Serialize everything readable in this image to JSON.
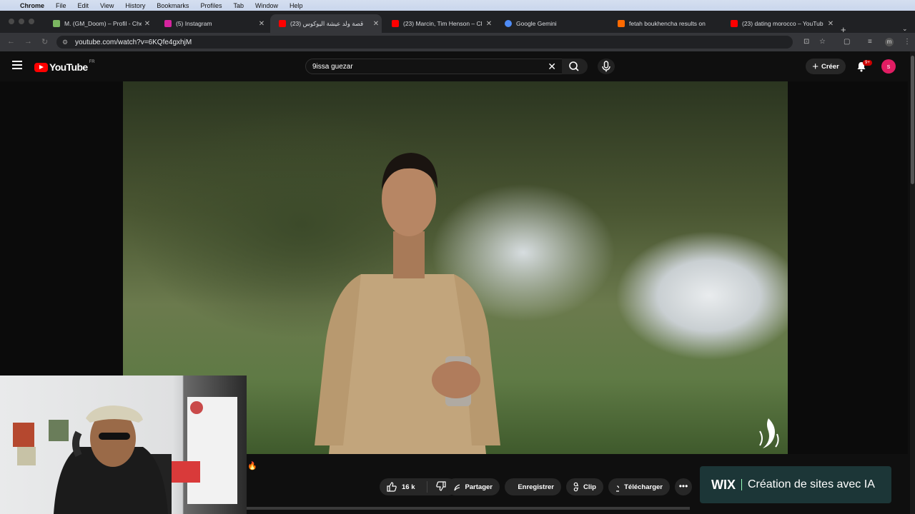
{
  "menubar": {
    "apple": "",
    "items": [
      "Chrome",
      "File",
      "Edit",
      "View",
      "History",
      "Bookmarks",
      "Profiles",
      "Tab",
      "Window",
      "Help"
    ]
  },
  "tabs": [
    {
      "title": "M. (GM_Doom) – Profil - Che",
      "color": "#7bb661"
    },
    {
      "title": "(5) Instagram",
      "color": "#d6249f"
    },
    {
      "title": "(23) قصة ولد عيشة اليوكوس",
      "color": "#ff0000"
    },
    {
      "title": "(23) Marcin, Tim Henson – Cl",
      "color": "#ff0000"
    },
    {
      "title": "Google Gemini",
      "color": "#4f8cf7"
    },
    {
      "title": "fetah boukhencha results on",
      "color": "#ff6a00"
    },
    {
      "title": "(23) dating morocco – YouTub",
      "color": "#ff0000"
    }
  ],
  "toolbar": {
    "url": "youtube.com/watch?v=6KQfe4gxhjM"
  },
  "youtube": {
    "logo": "YouTube",
    "country": "FR",
    "search_query": "9issa guezar",
    "create_label": "Créer",
    "notif_count": "9+",
    "avatar_letter": "s"
  },
  "actions": {
    "likes": "16 k",
    "share": "Partager",
    "save": "Enregistrer",
    "clip": "Clip",
    "download": "Télécharger"
  },
  "ad": {
    "logo": "WIX",
    "text": "Création de sites avec IA"
  },
  "profile_initial": "m",
  "colors": {
    "brand_red": "#ff0000",
    "avatar": "#e11d63",
    "ad_bg": "#1c3637"
  }
}
